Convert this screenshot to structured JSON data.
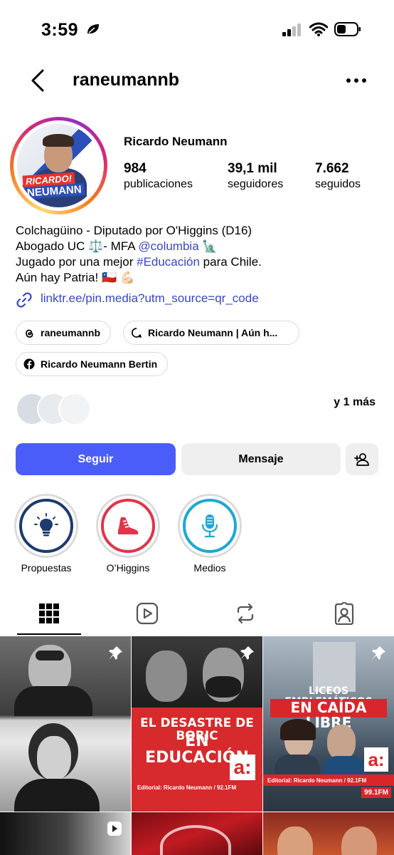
{
  "status_bar": {
    "time": "3:59"
  },
  "header": {
    "username": "raneumannb"
  },
  "profile": {
    "avatar_text_1": "RICARDO!",
    "avatar_text_2": "NEUMANN",
    "name": "Ricardo Neumann",
    "stats": [
      {
        "value": "984",
        "label": "publicaciones"
      },
      {
        "value": "39,1 mil",
        "label": "seguidores"
      },
      {
        "value": "7.662",
        "label": "seguidos"
      }
    ]
  },
  "bio": {
    "line1": "Colchagüino - Diputado por O'Higgins (D16)",
    "line2_a": "Abogado UC ⚖️- MFA ",
    "line2_mention": "@columbia",
    "line2_b": " 🗽",
    "line3_a": "Jugado por una mejor ",
    "line3_hashtag": "#Educación",
    "line3_b": " para Chile.",
    "line4": "Aún hay Patria! 🇨🇱 💪🏻",
    "link": "linktr.ee/pin.media?utm_source=qr_code"
  },
  "pills": [
    {
      "label": "raneumannb",
      "icon": "threads-icon"
    },
    {
      "label": "Ricardo Neumann | Aún h...",
      "icon": "threads-chat-icon"
    },
    {
      "label": "Ricardo Neumann Bertin",
      "icon": "facebook-icon"
    }
  ],
  "followed_by": {
    "text": "y 1 más"
  },
  "actions": {
    "follow": "Seguir",
    "message": "Mensaje"
  },
  "highlights": [
    {
      "label": "Propuestas",
      "icon": "lightbulb-icon",
      "color": "#1f3a6e"
    },
    {
      "label": "O’Higgins",
      "icon": "sneaker-icon",
      "color": "#e0344a"
    },
    {
      "label": "Medios",
      "icon": "microphone-icon",
      "color": "#1ea7d6"
    }
  ],
  "tabs": [
    {
      "name": "grid",
      "icon": "grid-icon"
    },
    {
      "name": "reels",
      "icon": "reels-icon"
    },
    {
      "name": "reposts",
      "icon": "repost-icon"
    },
    {
      "name": "tagged",
      "icon": "tagged-icon"
    }
  ],
  "posts": [
    {
      "title": "",
      "subtitle": ""
    },
    {
      "title": "EL DESASTRE DE BORIC EN EDUCACIÓN",
      "title_a": "EL DESASTRE DE BORIC",
      "title_b": "EN EDUCACIÓN",
      "subtitle": "Editorial: Ricardo Neumann / 92.1FM",
      "logo": "a:"
    },
    {
      "title_a": "LICEOS EMBLEMÁTICOS",
      "title_b": "EN CAÍDA LIBRE",
      "subtitle": "Editorial:  Ricardo Neumann  /  92.1FM",
      "logo": "a:",
      "freq": "99.1FM"
    }
  ],
  "colors": {
    "accent": "#4a5df9",
    "link": "#3847c4",
    "red": "#d9262b"
  }
}
